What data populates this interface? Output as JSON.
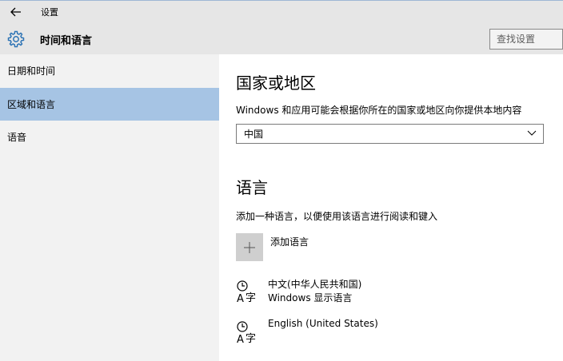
{
  "window": {
    "title": "设置",
    "heading": "时间和语言"
  },
  "search": {
    "placeholder": "查找设置"
  },
  "sidebar": {
    "items": [
      {
        "label": "日期和时间",
        "selected": false
      },
      {
        "label": "区域和语言",
        "selected": true
      },
      {
        "label": "语音",
        "selected": false
      }
    ]
  },
  "region": {
    "title": "国家或地区",
    "description": "Windows 和应用可能会根据你所在的国家或地区向你提供本地内容",
    "selected_value": "中国"
  },
  "language": {
    "title": "语言",
    "description": "添加一种语言，以便使用该语言进行阅读和键入",
    "add_label": "添加语言",
    "items": [
      {
        "name": "中文(中华人民共和国)",
        "sub": "Windows 显示语言"
      },
      {
        "name": "English (United States)",
        "sub": ""
      }
    ]
  },
  "colors": {
    "selected_nav": "#a6c4e4",
    "sidebar_bg": "#f2f2f2",
    "header_bg": "#e6e6e6",
    "accent": "#2e74b5"
  },
  "icons": {
    "back": "back-arrow-icon",
    "page": "gear-icon",
    "dropdown": "chevron-down-icon",
    "add": "plus-icon",
    "language": "language-icon"
  }
}
